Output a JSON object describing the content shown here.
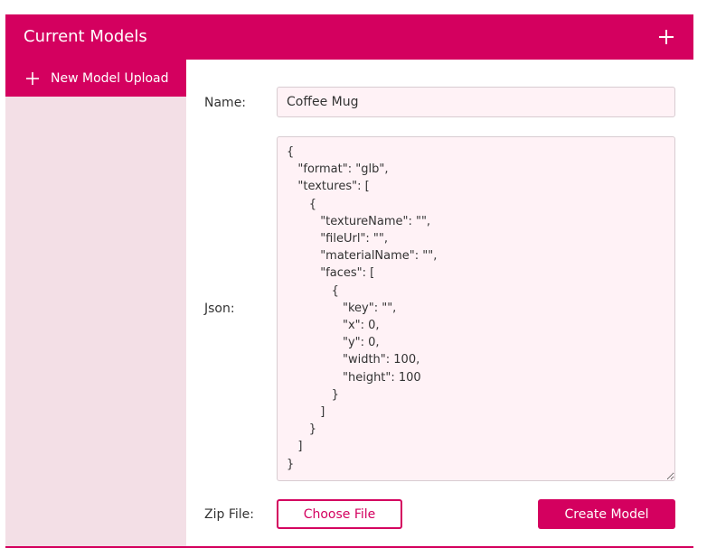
{
  "header": {
    "title": "Current Models",
    "add_icon": "plus-icon"
  },
  "sidebar": {
    "items": [
      {
        "label": "New Model Upload",
        "icon": "plus-icon"
      }
    ]
  },
  "form": {
    "name_label": "Name:",
    "name_value": "Coffee Mug",
    "json_label": "Json:",
    "json_value": "{\n   \"format\": \"glb\",\n   \"textures\": [\n      {\n         \"textureName\": \"\",\n         \"fileUrl\": \"\",\n         \"materialName\": \"\",\n         \"faces\": [\n            {\n               \"key\": \"\",\n               \"x\": 0,\n               \"y\": 0,\n               \"width\": 100,\n               \"height\": 100\n            }\n         ]\n      }\n   ]\n}",
    "zip_label": "Zip File:",
    "choose_file_label": "Choose File",
    "create_label": "Create Model"
  },
  "colors": {
    "accent": "#d4005f",
    "sidebar_bg": "#f3dfe6",
    "input_bg": "#fff2f6"
  }
}
